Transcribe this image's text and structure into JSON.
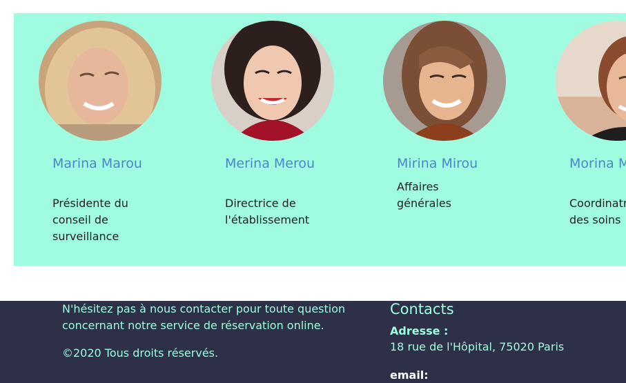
{
  "team": {
    "members": [
      {
        "name": "Marina Marou",
        "role": "Présidente du conseil de surveillance"
      },
      {
        "name": "Merina Merou",
        "role": "Directrice de l'établissement"
      },
      {
        "name": "Mirina Mirou",
        "role": "Affaires générales"
      },
      {
        "name": "Morina Morou",
        "role": "Coordinatrice des soins"
      }
    ]
  },
  "footer": {
    "about": "N'hésitez pas à nous contacter pour toute question concernant notre service de réservation online.",
    "copyright": "©2020 Tous droits réservés.",
    "contacts_title": "Contacts",
    "address_label": "Adresse :",
    "address_value": "18 rue de l'Hôpital, 75020 Paris",
    "email_label": "email:"
  },
  "colors": {
    "team_background": "#9ffce1",
    "name_color": "#4c86c6",
    "footer_background": "#2d3046",
    "footer_text": "#9ffce1"
  }
}
